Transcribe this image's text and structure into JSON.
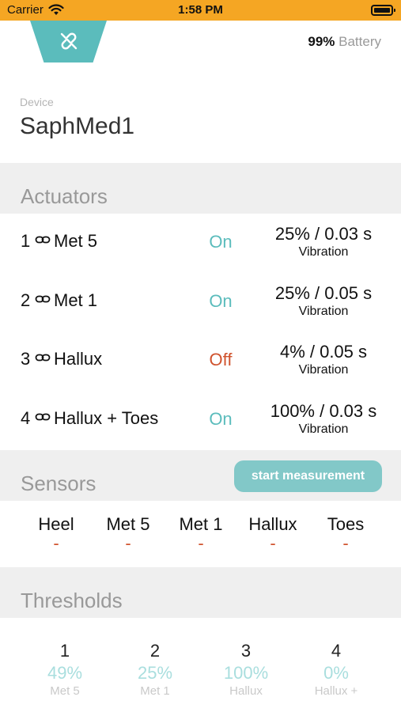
{
  "status_bar": {
    "carrier": "Carrier",
    "time": "1:58 PM"
  },
  "header": {
    "battery_pct": "99%",
    "battery_label": "Battery"
  },
  "device": {
    "label": "Device",
    "name": "SaphMed1"
  },
  "actuators": {
    "title": "Actuators",
    "items": [
      {
        "num": "1",
        "name": "Met 5",
        "state": "On",
        "value": "25% / 0.03 s",
        "mode": "Vibration"
      },
      {
        "num": "2",
        "name": "Met 1",
        "state": "On",
        "value": "25% / 0.05 s",
        "mode": "Vibration"
      },
      {
        "num": "3",
        "name": "Hallux",
        "state": "Off",
        "value": "4% / 0.05 s",
        "mode": "Vibration"
      },
      {
        "num": "4",
        "name": "Hallux + Toes",
        "state": "On",
        "value": "100% / 0.03 s",
        "mode": "Vibration"
      }
    ]
  },
  "sensors": {
    "title": "Sensors",
    "start_button": "start measurement",
    "items": [
      {
        "name": "Heel",
        "value": "-"
      },
      {
        "name": "Met 5",
        "value": "-"
      },
      {
        "name": "Met 1",
        "value": "-"
      },
      {
        "name": "Hallux",
        "value": "-"
      },
      {
        "name": "Toes",
        "value": "-"
      }
    ]
  },
  "thresholds": {
    "title": "Thresholds",
    "items": [
      {
        "num": "1",
        "pct": "49%",
        "name": "Met 5"
      },
      {
        "num": "2",
        "pct": "25%",
        "name": "Met 1"
      },
      {
        "num": "3",
        "pct": "100%",
        "name": "Hallux"
      },
      {
        "num": "4",
        "pct": "0%",
        "name": "Hallux +"
      }
    ]
  },
  "colors": {
    "status_bar": "#f5a623",
    "accent": "#5bbcbc",
    "off": "#d0532e",
    "section_bg": "#efefef"
  },
  "icons": {
    "connect": "unlink-icon",
    "wifi": "wifi-icon",
    "battery": "battery-icon",
    "actuator_link": "link-icon"
  }
}
